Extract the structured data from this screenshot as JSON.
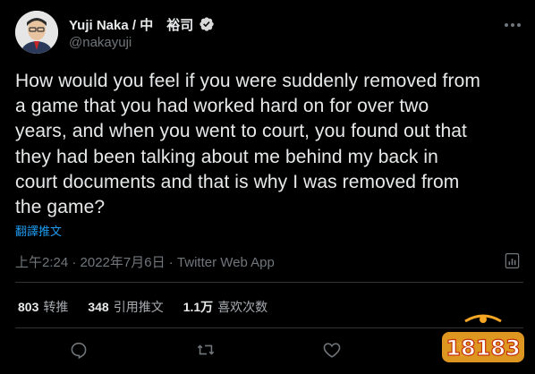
{
  "author": {
    "display_name": "Yuji Naka / 中　裕司",
    "handle": "@nakayuji"
  },
  "tweet": {
    "text": "How would you feel if you were suddenly removed from\na game that you had worked hard on for over two\nyears, and when you went to court, you found out that\nthey had been talking about me behind my back in\ncourt documents and that is why I was removed from\nthe game?",
    "translate_label": "翻譯推文",
    "timestamp": "上午2:24 · 2022年7月6日 · Twitter Web App"
  },
  "stats": {
    "retweets_value": "803",
    "retweets_label": "转推",
    "quotes_value": "348",
    "quotes_label": "引用推文",
    "likes_value": "1.1万",
    "likes_label": "喜欢次数"
  },
  "watermark": {
    "text": "18183"
  },
  "icons": {
    "verified": "verified-badge-icon",
    "more": "more-options-icon",
    "analytics": "analytics-icon",
    "reply": "reply-icon",
    "retweet": "retweet-icon",
    "like": "like-icon",
    "share": "share-icon"
  },
  "colors": {
    "background": "#000000",
    "text": "#e7e9ea",
    "secondary": "#71767b",
    "link": "#1d9bf0",
    "divider": "#2f3336",
    "watermark": "#f5a623"
  }
}
